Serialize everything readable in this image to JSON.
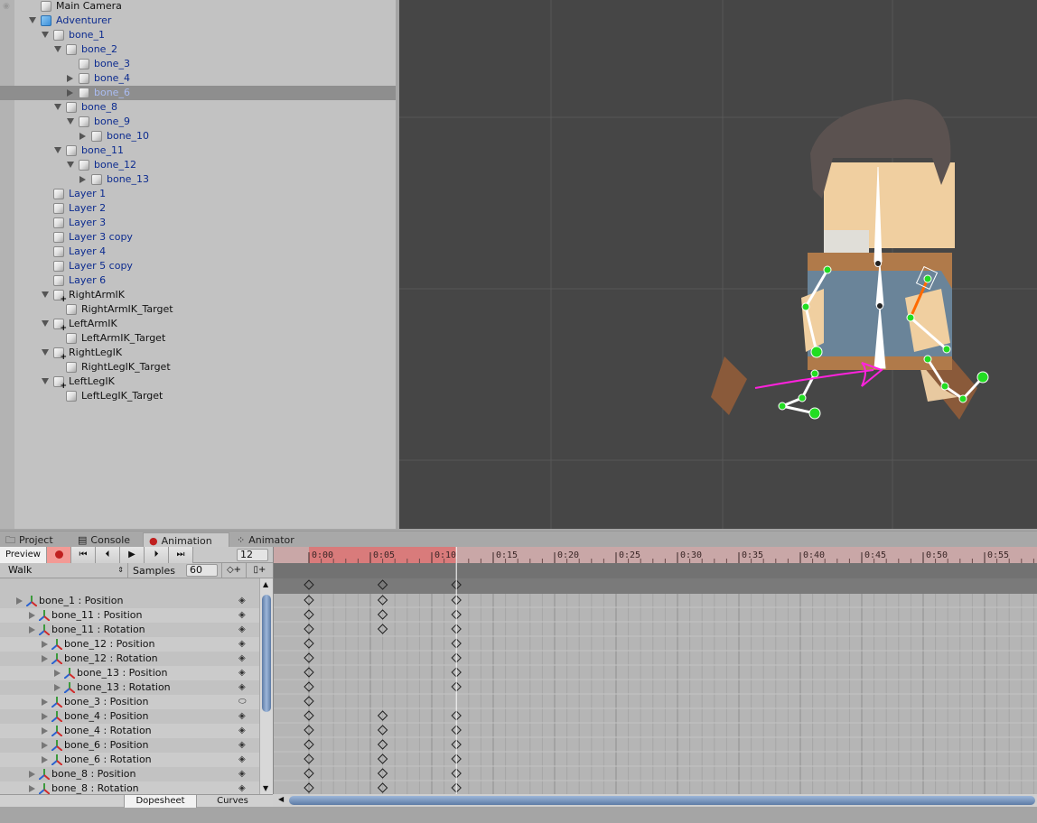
{
  "hierarchy": {
    "items": [
      {
        "label": "Main Camera",
        "depth": 0,
        "state": "none",
        "prefab": false
      },
      {
        "label": "Adventurer",
        "depth": 0,
        "state": "open",
        "prefab": true,
        "root": true
      },
      {
        "label": "bone_1",
        "depth": 1,
        "state": "open",
        "prefab": true
      },
      {
        "label": "bone_2",
        "depth": 2,
        "state": "open",
        "prefab": true
      },
      {
        "label": "bone_3",
        "depth": 3,
        "state": "none",
        "prefab": true
      },
      {
        "label": "bone_4",
        "depth": 3,
        "state": "closed",
        "prefab": true
      },
      {
        "label": "bone_6",
        "depth": 3,
        "state": "closed",
        "prefab": true,
        "selected": true
      },
      {
        "label": "bone_8",
        "depth": 2,
        "state": "open",
        "prefab": true
      },
      {
        "label": "bone_9",
        "depth": 3,
        "state": "open",
        "prefab": true
      },
      {
        "label": "bone_10",
        "depth": 4,
        "state": "closed",
        "prefab": true
      },
      {
        "label": "bone_11",
        "depth": 2,
        "state": "open",
        "prefab": true
      },
      {
        "label": "bone_12",
        "depth": 3,
        "state": "open",
        "prefab": true
      },
      {
        "label": "bone_13",
        "depth": 4,
        "state": "closed",
        "prefab": true
      },
      {
        "label": "Layer 1",
        "depth": 1,
        "state": "none",
        "prefab": true
      },
      {
        "label": "Layer 2",
        "depth": 1,
        "state": "none",
        "prefab": true
      },
      {
        "label": "Layer 3",
        "depth": 1,
        "state": "none",
        "prefab": true
      },
      {
        "label": "Layer 3 copy",
        "depth": 1,
        "state": "none",
        "prefab": true
      },
      {
        "label": "Layer 4",
        "depth": 1,
        "state": "none",
        "prefab": true
      },
      {
        "label": "Layer 5 copy",
        "depth": 1,
        "state": "none",
        "prefab": true
      },
      {
        "label": "Layer 6",
        "depth": 1,
        "state": "none",
        "prefab": true
      },
      {
        "label": "RightArmIK",
        "depth": 1,
        "state": "open",
        "prefab": false,
        "ik": true
      },
      {
        "label": "RightArmIK_Target",
        "depth": 2,
        "state": "none",
        "prefab": false
      },
      {
        "label": "LeftArmIK",
        "depth": 1,
        "state": "open",
        "prefab": false,
        "ik": true
      },
      {
        "label": "LeftArmIK_Target",
        "depth": 2,
        "state": "none",
        "prefab": false
      },
      {
        "label": "RightLegIK",
        "depth": 1,
        "state": "open",
        "prefab": false,
        "ik": true
      },
      {
        "label": "RightLegIK_Target",
        "depth": 2,
        "state": "none",
        "prefab": false
      },
      {
        "label": "LeftLegIK",
        "depth": 1,
        "state": "open",
        "prefab": false,
        "ik": true
      },
      {
        "label": "LeftLegIK_Target",
        "depth": 2,
        "state": "none",
        "prefab": false
      }
    ]
  },
  "tabs": [
    {
      "label": "Project",
      "icon": "folder-icon"
    },
    {
      "label": "Console",
      "icon": "console-icon"
    },
    {
      "label": "Animation",
      "icon": "record-dot-icon",
      "active": true
    },
    {
      "label": "Animator",
      "icon": "animator-icon"
    }
  ],
  "animation": {
    "preview_label": "Preview",
    "frame": "12",
    "clip": "Walk",
    "samples_label": "Samples",
    "samples": "60",
    "record_color": "#c0201f",
    "dopesheet_label": "Dopesheet",
    "curves_label": "Curves",
    "ruler": [
      "0:00",
      "0:05",
      "0:10",
      "0:15",
      "0:20",
      "0:25",
      "0:30",
      "0:35",
      "0:40",
      "0:45",
      "0:50",
      "0:55"
    ],
    "summary_keys": [
      0,
      6,
      12
    ],
    "properties": [
      {
        "label": "bone_1 : Position",
        "depth": 0,
        "keys": [
          0,
          6,
          12
        ]
      },
      {
        "label": "bone_11 : Position",
        "depth": 1,
        "keys": [
          0,
          6,
          12
        ]
      },
      {
        "label": "bone_11 : Rotation",
        "depth": 1,
        "keys": [
          0,
          6,
          12
        ]
      },
      {
        "label": "bone_12 : Position",
        "depth": 2,
        "keys": [
          0,
          12
        ]
      },
      {
        "label": "bone_12 : Rotation",
        "depth": 2,
        "keys": [
          0,
          12
        ]
      },
      {
        "label": "bone_13 : Position",
        "depth": 3,
        "keys": [
          0,
          12
        ]
      },
      {
        "label": "bone_13 : Rotation",
        "depth": 3,
        "keys": [
          0,
          12
        ]
      },
      {
        "label": "bone_3 : Position",
        "depth": 2,
        "keys": [
          0
        ]
      },
      {
        "label": "bone_4 : Position",
        "depth": 2,
        "keys": [
          0,
          6,
          12
        ]
      },
      {
        "label": "bone_4 : Rotation",
        "depth": 2,
        "keys": [
          0,
          6,
          12
        ]
      },
      {
        "label": "bone_6 : Position",
        "depth": 2,
        "keys": [
          0,
          6,
          12
        ]
      },
      {
        "label": "bone_6 : Rotation",
        "depth": 2,
        "keys": [
          0,
          6,
          12
        ]
      },
      {
        "label": "bone_8 : Position",
        "depth": 1,
        "keys": [
          0,
          6,
          12
        ]
      },
      {
        "label": "bone_8 : Rotation",
        "depth": 1,
        "keys": [
          0,
          6,
          12
        ]
      }
    ]
  }
}
